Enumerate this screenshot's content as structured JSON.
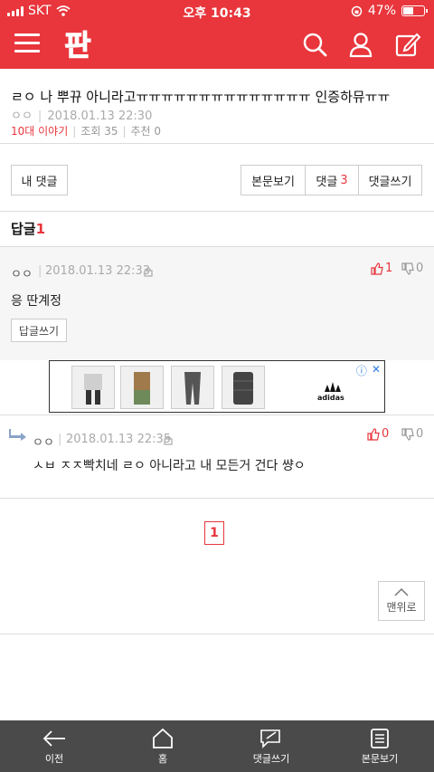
{
  "status_bar": {
    "carrier": "SKT",
    "time": "오후 10:43",
    "battery": "47%",
    "battery_level": 0.47
  },
  "header": {
    "logo": "판"
  },
  "post": {
    "title": "ㄹㅇ 나 뿌뀨 아니라고ㅠㅠㅠㅠㅠㅠㅠㅠㅠㅠㅠㅠㅠㅠ 인증하뮤ㅠㅠ",
    "author": "ㅇㅇ",
    "date": "2018.01.13 22:30",
    "category": "10대 이야기",
    "views": "조회 35",
    "recommends": "추천 0"
  },
  "actions": {
    "my_comments": "내 댓글",
    "view_post": "본문보기",
    "comments_label": "댓글",
    "comments_count": "3",
    "write_comment": "댓글쓰기"
  },
  "replies": {
    "label": "답글",
    "count": "1",
    "main": {
      "author": "ㅇㅇ",
      "date": "2018.01.13 22:33",
      "text": "응 딴계정",
      "up": "1",
      "down": "0",
      "reply_btn": "답글쓰기"
    },
    "sub": {
      "author": "ㅇㅇ",
      "date": "2018.01.13 22:35",
      "text": "ㅅㅂ ㅈㅈ빡치네 ㄹㅇ 아니라고 내 모든거 건다 썅ㅇ",
      "up": "0",
      "down": "0"
    }
  },
  "ad": {
    "brand": "adidas"
  },
  "pagination": {
    "current": "1"
  },
  "to_top": "맨위로",
  "bottom_nav": {
    "back": "이전",
    "home": "홈",
    "write": "댓글쓰기",
    "view_post": "본문보기"
  },
  "colors": {
    "brand": "#e8363c",
    "nav_bg": "#4a4a4a"
  }
}
